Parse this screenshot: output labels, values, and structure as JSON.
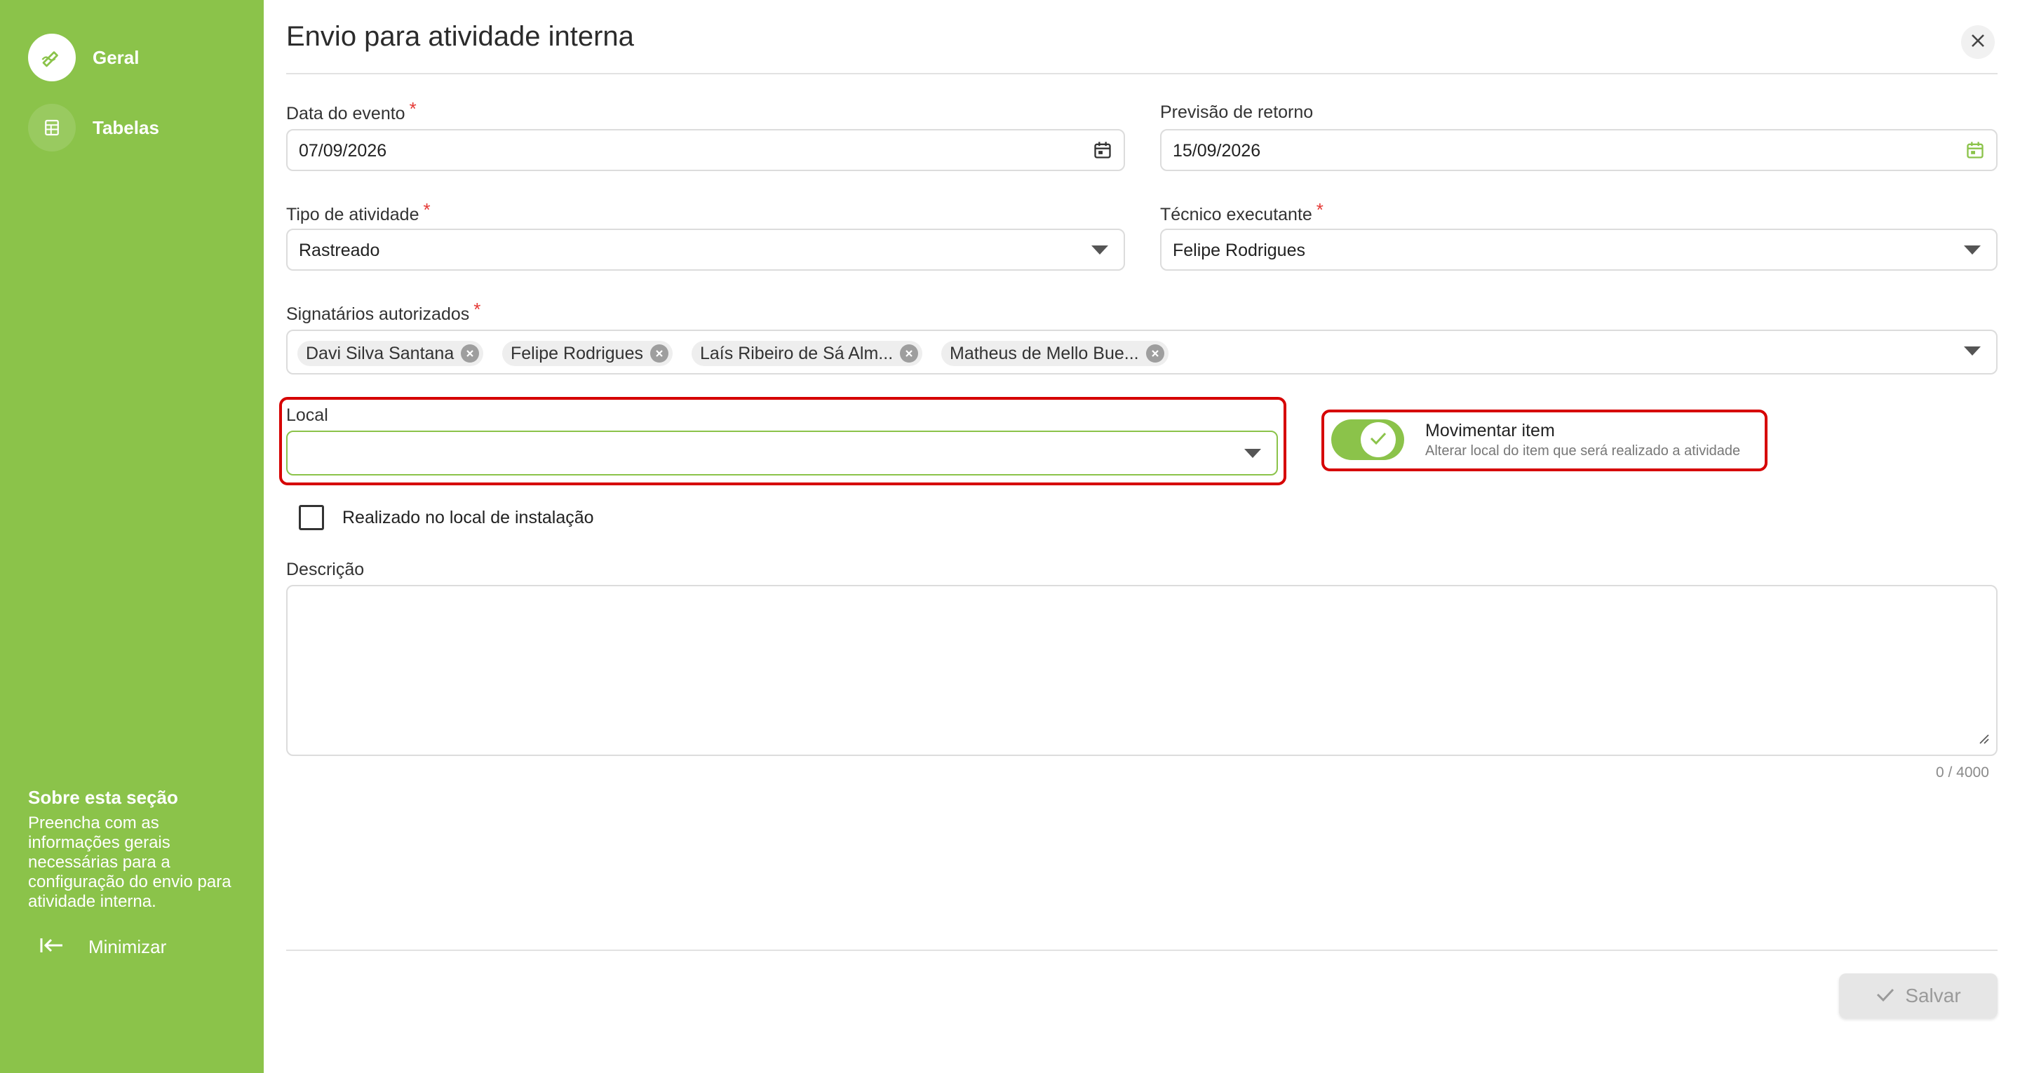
{
  "sidebar": {
    "items": [
      {
        "label": "Geral",
        "icon": "pencil-icon",
        "active": true
      },
      {
        "label": "Tabelas",
        "icon": "table-icon",
        "active": false
      }
    ],
    "about": {
      "title": "Sobre esta seção",
      "text": "Preencha com as informações gerais necessárias para a configuração do envio para atividade interna."
    },
    "minimize_label": "Minimizar"
  },
  "dialog": {
    "title": "Envio para atividade interna",
    "close_icon": "close-icon"
  },
  "form": {
    "data_evento": {
      "label": "Data do evento",
      "required": "*",
      "value": "07/09/2026"
    },
    "previsao_retorno": {
      "label": "Previsão de retorno",
      "value": "15/09/2026"
    },
    "tipo_atividade": {
      "label": "Tipo de atividade",
      "required": "*",
      "value": "Rastreado"
    },
    "tecnico_executante": {
      "label": "Técnico executante",
      "required": "*",
      "value": "Felipe Rodrigues"
    },
    "signatarios": {
      "label": "Signatários autorizados",
      "required": "*",
      "chips": [
        "Davi Silva Santana",
        "Felipe Rodrigues",
        "Laís Ribeiro de Sá Alm...",
        "Matheus de Mello Bue..."
      ]
    },
    "local": {
      "label": "Local",
      "value": ""
    },
    "movimentar_item": {
      "title": "Movimentar item",
      "description": "Alterar local do item que será realizado a atividade",
      "checked": true
    },
    "realizado_local": {
      "label": "Realizado no local de instalação",
      "checked": false
    },
    "descricao": {
      "label": "Descrição",
      "value": "",
      "counter": "0 / 4000"
    }
  },
  "footer": {
    "save_label": "Salvar"
  },
  "colors": {
    "brand_green": "#8bc34a",
    "highlight_red": "#d60000",
    "required_red": "#e53935"
  }
}
